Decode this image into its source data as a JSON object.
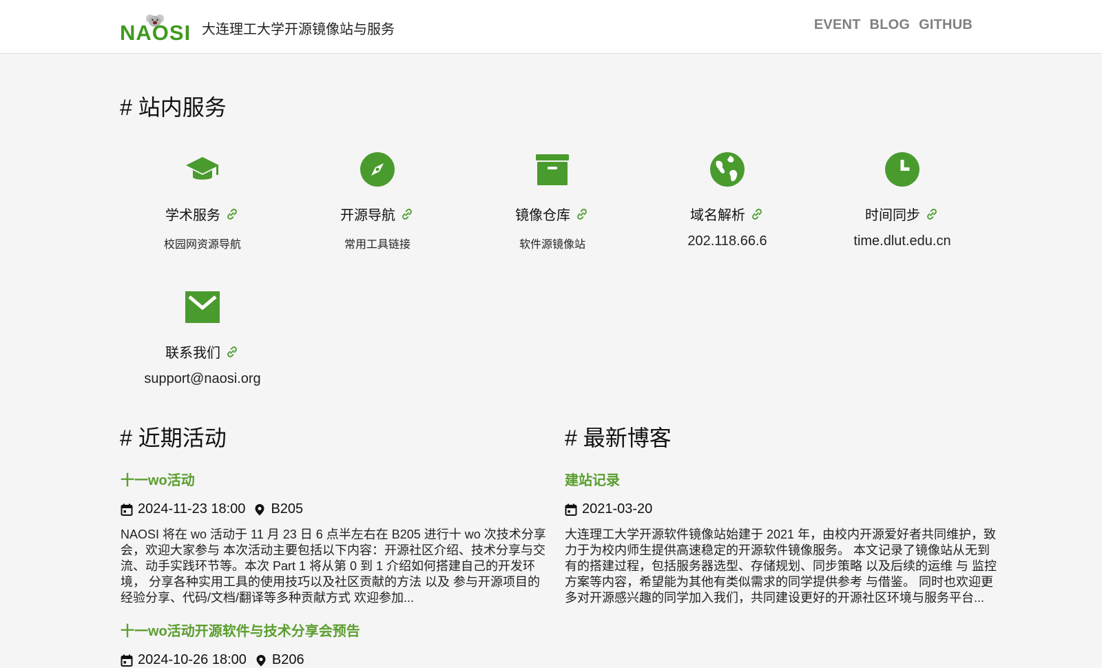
{
  "header": {
    "logo_text": "NAOSI",
    "site_title": "大连理工大学开源镜像站与服务",
    "nav": [
      "EVENT",
      "BLOG",
      "GITHUB"
    ]
  },
  "services": {
    "title": "# 站内服务",
    "items": [
      {
        "icon": "graduation-cap-icon",
        "name": "学术服务",
        "desc": "校园网资源导航"
      },
      {
        "icon": "compass-icon",
        "name": "开源导航",
        "desc": "常用工具链接"
      },
      {
        "icon": "archive-box-icon",
        "name": "镜像仓库",
        "desc": "软件源镜像站"
      },
      {
        "icon": "globe-icon",
        "name": "域名解析",
        "desc": "202.118.66.6"
      },
      {
        "icon": "clock-icon",
        "name": "时间同步",
        "desc": "time.dlut.edu.cn"
      },
      {
        "icon": "mail-icon",
        "name": "联系我们",
        "desc": "support@naosi.org"
      }
    ]
  },
  "events": {
    "title": "# 近期活动",
    "items": [
      {
        "title": "十一wo活动",
        "date": "2024-11-23 18:00",
        "location": "B205",
        "excerpt": "NAOSI 将在 wo 活动于 11 月 23 日 6 点半左右在 B205 进行十 wo 次技术分享会，欢迎大家参与 本次活动主要包括以下内容：开源社区介绍、技术分享与交流、动手实践环节等。本次 Part 1 将从第 0 到 1 介绍如何搭建自己的开发环境， 分享各种实用工具的使用技巧以及社区贡献的方法 以及 参与开源项目的经验分享、代码/文档/翻译等多种贡献方式 欢迎参加..."
      },
      {
        "title": "十一wo活动开源软件与技术分享会预告",
        "date": "2024-10-26 18:00",
        "location": "B206"
      }
    ]
  },
  "blog": {
    "title": "# 最新博客",
    "items": [
      {
        "title": "建站记录",
        "date": "2021-03-20",
        "excerpt": "大连理工大学开源软件镜像站始建于 2021 年，由校内开源爱好者共同维护，致力于为校内师生提供高速稳定的开源软件镜像服务。 本文记录了镜像站从无到有的搭建过程，包括服务器选型、存储规划、同步策略 以及后续的运维 与 监控方案等内容，希望能为其他有类似需求的同学提供参考 与借鉴。 同时也欢迎更多对开源感兴趣的同学加入我们，共同建设更好的开源社区环境与服务平台..."
      }
    ]
  },
  "colors": {
    "accent": "#5a9e2f",
    "icon_green": "#4a9b2e",
    "nav_gray": "#808080"
  }
}
